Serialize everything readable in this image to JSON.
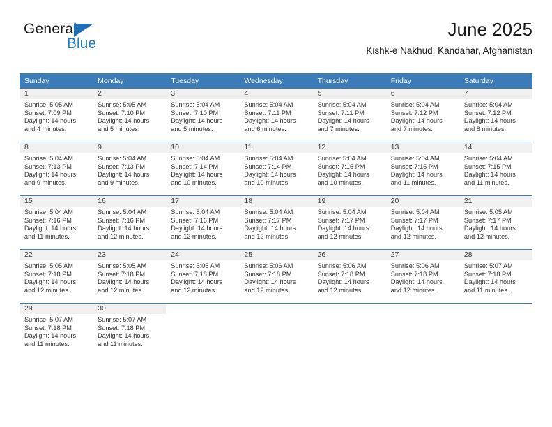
{
  "brand": {
    "name_part1": "General",
    "name_part2": "Blue",
    "triangle_color": "#1f6fb5",
    "blue_color": "#1f7ac4"
  },
  "header": {
    "title": "June 2025",
    "subtitle": "Kishk-e Nakhud, Kandahar, Afghanistan"
  },
  "theme": {
    "header_bg": "#3b7cb8",
    "daynum_band": "#f0f0f0",
    "row_divider": "#3b7cb8"
  },
  "weekdays": [
    "Sunday",
    "Monday",
    "Tuesday",
    "Wednesday",
    "Thursday",
    "Friday",
    "Saturday"
  ],
  "weeks": [
    [
      {
        "day": "1",
        "sunrise": "Sunrise: 5:05 AM",
        "sunset": "Sunset: 7:09 PM",
        "daylight1": "Daylight: 14 hours",
        "daylight2": "and 4 minutes."
      },
      {
        "day": "2",
        "sunrise": "Sunrise: 5:05 AM",
        "sunset": "Sunset: 7:10 PM",
        "daylight1": "Daylight: 14 hours",
        "daylight2": "and 5 minutes."
      },
      {
        "day": "3",
        "sunrise": "Sunrise: 5:04 AM",
        "sunset": "Sunset: 7:10 PM",
        "daylight1": "Daylight: 14 hours",
        "daylight2": "and 5 minutes."
      },
      {
        "day": "4",
        "sunrise": "Sunrise: 5:04 AM",
        "sunset": "Sunset: 7:11 PM",
        "daylight1": "Daylight: 14 hours",
        "daylight2": "and 6 minutes."
      },
      {
        "day": "5",
        "sunrise": "Sunrise: 5:04 AM",
        "sunset": "Sunset: 7:11 PM",
        "daylight1": "Daylight: 14 hours",
        "daylight2": "and 7 minutes."
      },
      {
        "day": "6",
        "sunrise": "Sunrise: 5:04 AM",
        "sunset": "Sunset: 7:12 PM",
        "daylight1": "Daylight: 14 hours",
        "daylight2": "and 7 minutes."
      },
      {
        "day": "7",
        "sunrise": "Sunrise: 5:04 AM",
        "sunset": "Sunset: 7:12 PM",
        "daylight1": "Daylight: 14 hours",
        "daylight2": "and 8 minutes."
      }
    ],
    [
      {
        "day": "8",
        "sunrise": "Sunrise: 5:04 AM",
        "sunset": "Sunset: 7:13 PM",
        "daylight1": "Daylight: 14 hours",
        "daylight2": "and 9 minutes."
      },
      {
        "day": "9",
        "sunrise": "Sunrise: 5:04 AM",
        "sunset": "Sunset: 7:13 PM",
        "daylight1": "Daylight: 14 hours",
        "daylight2": "and 9 minutes."
      },
      {
        "day": "10",
        "sunrise": "Sunrise: 5:04 AM",
        "sunset": "Sunset: 7:14 PM",
        "daylight1": "Daylight: 14 hours",
        "daylight2": "and 10 minutes."
      },
      {
        "day": "11",
        "sunrise": "Sunrise: 5:04 AM",
        "sunset": "Sunset: 7:14 PM",
        "daylight1": "Daylight: 14 hours",
        "daylight2": "and 10 minutes."
      },
      {
        "day": "12",
        "sunrise": "Sunrise: 5:04 AM",
        "sunset": "Sunset: 7:15 PM",
        "daylight1": "Daylight: 14 hours",
        "daylight2": "and 10 minutes."
      },
      {
        "day": "13",
        "sunrise": "Sunrise: 5:04 AM",
        "sunset": "Sunset: 7:15 PM",
        "daylight1": "Daylight: 14 hours",
        "daylight2": "and 11 minutes."
      },
      {
        "day": "14",
        "sunrise": "Sunrise: 5:04 AM",
        "sunset": "Sunset: 7:15 PM",
        "daylight1": "Daylight: 14 hours",
        "daylight2": "and 11 minutes."
      }
    ],
    [
      {
        "day": "15",
        "sunrise": "Sunrise: 5:04 AM",
        "sunset": "Sunset: 7:16 PM",
        "daylight1": "Daylight: 14 hours",
        "daylight2": "and 11 minutes."
      },
      {
        "day": "16",
        "sunrise": "Sunrise: 5:04 AM",
        "sunset": "Sunset: 7:16 PM",
        "daylight1": "Daylight: 14 hours",
        "daylight2": "and 12 minutes."
      },
      {
        "day": "17",
        "sunrise": "Sunrise: 5:04 AM",
        "sunset": "Sunset: 7:16 PM",
        "daylight1": "Daylight: 14 hours",
        "daylight2": "and 12 minutes."
      },
      {
        "day": "18",
        "sunrise": "Sunrise: 5:04 AM",
        "sunset": "Sunset: 7:17 PM",
        "daylight1": "Daylight: 14 hours",
        "daylight2": "and 12 minutes."
      },
      {
        "day": "19",
        "sunrise": "Sunrise: 5:04 AM",
        "sunset": "Sunset: 7:17 PM",
        "daylight1": "Daylight: 14 hours",
        "daylight2": "and 12 minutes."
      },
      {
        "day": "20",
        "sunrise": "Sunrise: 5:04 AM",
        "sunset": "Sunset: 7:17 PM",
        "daylight1": "Daylight: 14 hours",
        "daylight2": "and 12 minutes."
      },
      {
        "day": "21",
        "sunrise": "Sunrise: 5:05 AM",
        "sunset": "Sunset: 7:17 PM",
        "daylight1": "Daylight: 14 hours",
        "daylight2": "and 12 minutes."
      }
    ],
    [
      {
        "day": "22",
        "sunrise": "Sunrise: 5:05 AM",
        "sunset": "Sunset: 7:18 PM",
        "daylight1": "Daylight: 14 hours",
        "daylight2": "and 12 minutes."
      },
      {
        "day": "23",
        "sunrise": "Sunrise: 5:05 AM",
        "sunset": "Sunset: 7:18 PM",
        "daylight1": "Daylight: 14 hours",
        "daylight2": "and 12 minutes."
      },
      {
        "day": "24",
        "sunrise": "Sunrise: 5:05 AM",
        "sunset": "Sunset: 7:18 PM",
        "daylight1": "Daylight: 14 hours",
        "daylight2": "and 12 minutes."
      },
      {
        "day": "25",
        "sunrise": "Sunrise: 5:06 AM",
        "sunset": "Sunset: 7:18 PM",
        "daylight1": "Daylight: 14 hours",
        "daylight2": "and 12 minutes."
      },
      {
        "day": "26",
        "sunrise": "Sunrise: 5:06 AM",
        "sunset": "Sunset: 7:18 PM",
        "daylight1": "Daylight: 14 hours",
        "daylight2": "and 12 minutes."
      },
      {
        "day": "27",
        "sunrise": "Sunrise: 5:06 AM",
        "sunset": "Sunset: 7:18 PM",
        "daylight1": "Daylight: 14 hours",
        "daylight2": "and 12 minutes."
      },
      {
        "day": "28",
        "sunrise": "Sunrise: 5:07 AM",
        "sunset": "Sunset: 7:18 PM",
        "daylight1": "Daylight: 14 hours",
        "daylight2": "and 11 minutes."
      }
    ],
    [
      {
        "day": "29",
        "sunrise": "Sunrise: 5:07 AM",
        "sunset": "Sunset: 7:18 PM",
        "daylight1": "Daylight: 14 hours",
        "daylight2": "and 11 minutes."
      },
      {
        "day": "30",
        "sunrise": "Sunrise: 5:07 AM",
        "sunset": "Sunset: 7:18 PM",
        "daylight1": "Daylight: 14 hours",
        "daylight2": "and 11 minutes."
      },
      null,
      null,
      null,
      null,
      null
    ]
  ]
}
